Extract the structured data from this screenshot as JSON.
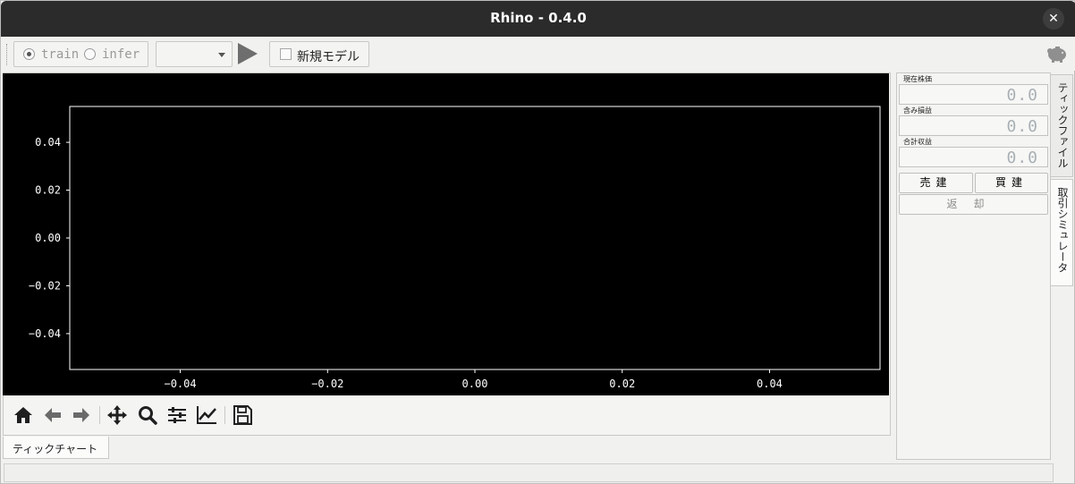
{
  "window": {
    "title": "Rhino - 0.4.0",
    "close_icon": "close-icon"
  },
  "toolbar": {
    "mode_train": "train",
    "mode_infer": "infer",
    "mode_selected": "train",
    "model_select_value": "",
    "run_icon": "play-icon",
    "new_model_label": "新規モデル",
    "new_model_checked": false,
    "app_icon": "piggy-bank-icon"
  },
  "chart": {
    "toolbar_icons": [
      "home-icon",
      "back-icon",
      "forward-icon",
      "pan-icon",
      "zoom-icon",
      "configure-subplots-icon",
      "edit-axis-icon",
      "save-icon"
    ]
  },
  "chart_data": {
    "type": "line",
    "series": [],
    "x_ticks": [
      "−0.04",
      "−0.02",
      "0.00",
      "0.02",
      "0.04"
    ],
    "y_ticks": [
      "0.04",
      "0.02",
      "0.00",
      "−0.02",
      "−0.04"
    ],
    "xlim": [
      -0.055,
      0.055
    ],
    "ylim": [
      -0.055,
      0.055
    ],
    "title": "",
    "xlabel": "",
    "ylabel": "",
    "background": "#000000",
    "foreground": "#ffffff"
  },
  "bottom_tabs": {
    "tick_chart": "ティックチャート"
  },
  "simulator": {
    "current_price_label": "現在株価",
    "current_price_value": "0.0",
    "unrealized_label": "含み損益",
    "unrealized_value": "0.0",
    "total_label": "合計収益",
    "total_value": "0.0",
    "sell_label": "売建",
    "buy_label": "買建",
    "repay_label": "返却"
  },
  "side_tabs": {
    "tick_file": "ティックファイル",
    "trade_sim": "取引シミュレータ"
  }
}
